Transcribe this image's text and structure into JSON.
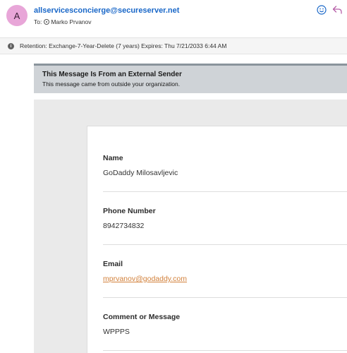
{
  "header": {
    "avatar_initial": "A",
    "sender": "allservicesconcierge@secureserver.net",
    "to_label": "To:",
    "recipient": "Marko Prvanov",
    "icons": {
      "emoji": "smiley-icon",
      "reply": "reply-arrow-icon"
    }
  },
  "retention": {
    "text": "Retention: Exchange-7-Year-Delete (7 years) Expires: Thu 7/21/2033 6:44 AM"
  },
  "external_banner": {
    "title": "This Message Is From an External Sender",
    "subtitle": "This message came from outside your organization."
  },
  "fields": [
    {
      "label": "Name",
      "value": "GoDaddy Milosavljevic"
    },
    {
      "label": "Phone Number",
      "value": "8942734832"
    },
    {
      "label": "Email",
      "value": "mprvanov@godaddy.com"
    },
    {
      "label": "Comment or Message",
      "value": "WPPPS"
    }
  ],
  "colors": {
    "sender": "#1967c8",
    "avatar": "#e8a6d8",
    "banner": "#cfd3d7",
    "reply_icon": "#b65fa8",
    "emoji_icon": "#1967c8",
    "link": "#d2803a"
  }
}
